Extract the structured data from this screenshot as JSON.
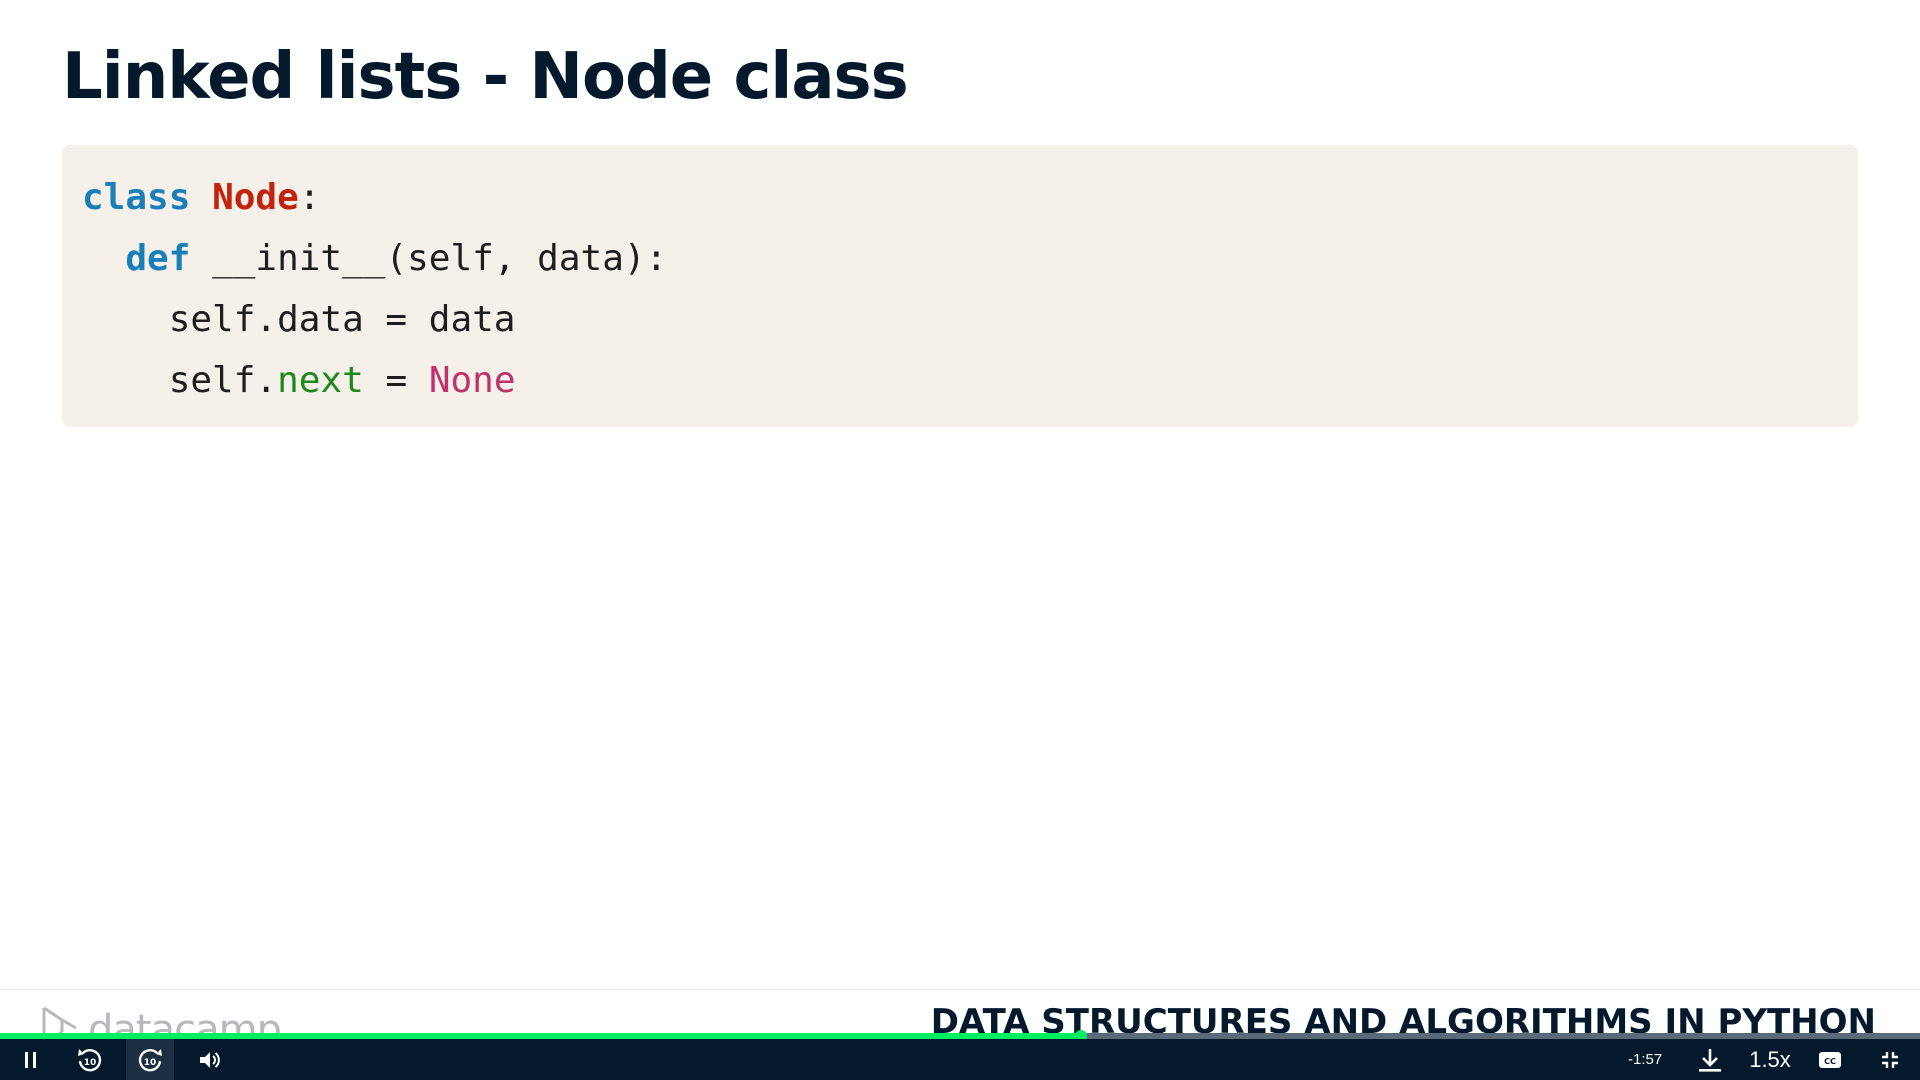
{
  "slide": {
    "title": "Linked lists - Node class",
    "code_lines": [
      [
        {
          "text": "class",
          "type": "kw"
        },
        {
          "text": " ",
          "type": "plain"
        },
        {
          "text": "Node",
          "type": "class"
        },
        {
          "text": ":",
          "type": "plain"
        }
      ],
      [
        {
          "text": "  ",
          "type": "plain"
        },
        {
          "text": "def",
          "type": "kw"
        },
        {
          "text": " __init__(self, data):",
          "type": "plain"
        }
      ],
      [
        {
          "text": "    self.data = data",
          "type": "plain"
        }
      ],
      [
        {
          "text": "    self.",
          "type": "plain"
        },
        {
          "text": "next",
          "type": "attr"
        },
        {
          "text": " = ",
          "type": "plain"
        },
        {
          "text": "None",
          "type": "const"
        }
      ]
    ],
    "footer": {
      "brand": "datacamp",
      "course": "DATA STRUCTURES AND ALGORITHMS IN PYTHON"
    }
  },
  "player": {
    "progress_fraction": 0.563,
    "time_remaining": "-1:57",
    "speed": "1.5x",
    "icons": {
      "play_pause": "pause-icon",
      "rewind": "rewind-10-icon",
      "forward": "forward-10-icon",
      "volume": "volume-icon",
      "download": "download-icon",
      "captions": "captions-icon",
      "fullscreen": "exit-fullscreen-icon"
    },
    "colors": {
      "bar": "#05192d",
      "progress": "#03ef62"
    }
  },
  "colors": {
    "title": "#05192d",
    "code_bg": "#f5f1ea",
    "keyword": "#1a7fb8",
    "class_name": "#c3230c",
    "attribute": "#1b8a1b",
    "constant": "#c2306b"
  }
}
